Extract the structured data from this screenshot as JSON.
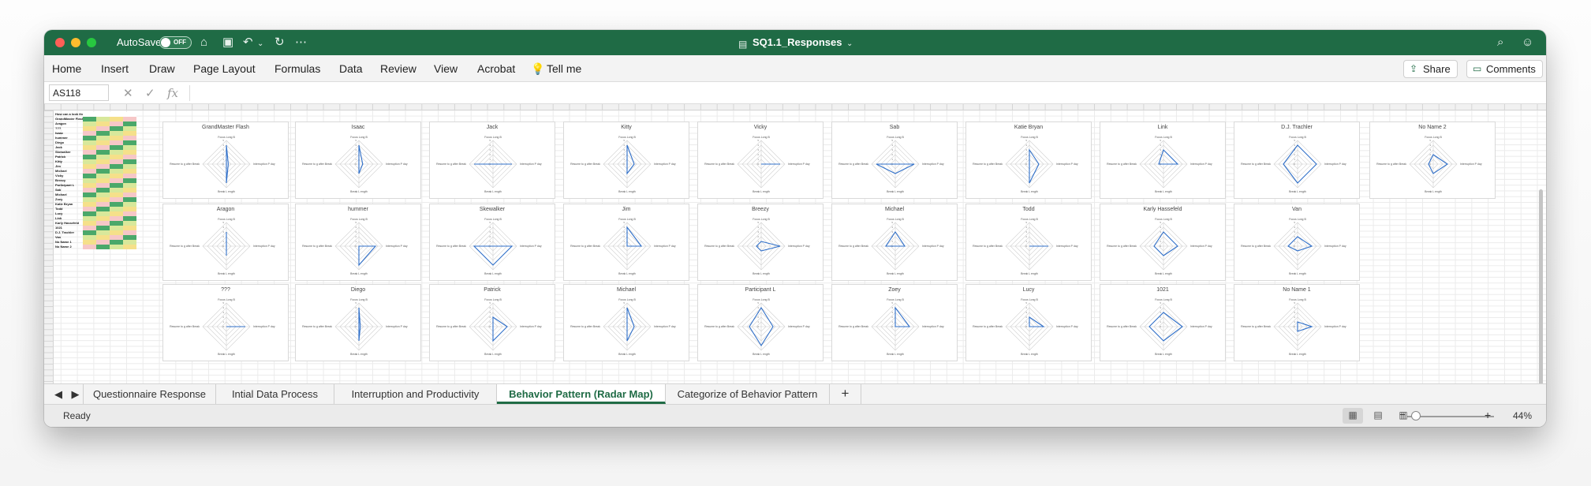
{
  "window": {
    "title": "SQ1.1_Responses"
  },
  "titlebar": {
    "autosave_label": "AutoSave",
    "toggle_state": "OFF"
  },
  "ribbon": {
    "tabs": [
      "Home",
      "Insert",
      "Draw",
      "Page Layout",
      "Formulas",
      "Data",
      "Review",
      "View",
      "Acrobat"
    ],
    "tell_me": "Tell me",
    "share": "Share",
    "comments": "Comments"
  },
  "formula_bar": {
    "name_box": "AS118",
    "fx": "fx",
    "value": ""
  },
  "data_table": {
    "rows": [
      "How can a look the le",
      "GrandMaster Flash",
      "Aragon",
      "???",
      "Isaac",
      "hummer",
      "Diego",
      "Jack",
      "Skewalker",
      "Patrick",
      "Kitty",
      "Jim",
      "Michael",
      "Vicky",
      "Breezy",
      "Participant L",
      "Sab",
      "Michael",
      "Zoey",
      "Katie Bryan",
      "Todd",
      "Lucy",
      "Link",
      "Karly Hassefeld",
      "1021",
      "D.J. Trachler",
      "Van",
      "No Name 1",
      "No Name 2"
    ],
    "colors": [
      "#f6c7c7",
      "#4aa86a",
      "#d8e89b",
      "#f5e08a"
    ]
  },
  "radar_axes": [
    "Focus Long B",
    "Interruption P day",
    "Break L ength",
    "Resume to g after Break"
  ],
  "radar_ticks": [
    "5",
    "4",
    "3",
    "2",
    "1",
    "0"
  ],
  "charts": [
    {
      "name": "GrandMaster Flash",
      "values": [
        4,
        0.4,
        4,
        0
      ]
    },
    {
      "name": "Aragon",
      "values": [
        3,
        0,
        2,
        0
      ]
    },
    {
      "name": "???",
      "values": [
        0,
        4,
        0,
        0
      ]
    },
    {
      "name": "Isaac",
      "values": [
        4,
        0.8,
        2,
        0
      ]
    },
    {
      "name": "hummer",
      "values": [
        0,
        3.5,
        4,
        0
      ]
    },
    {
      "name": "Diego",
      "values": [
        4,
        0.3,
        3,
        0
      ]
    },
    {
      "name": "Jack",
      "values": [
        0,
        4,
        0,
        4
      ]
    },
    {
      "name": "Skewalker",
      "values": [
        0,
        4,
        4,
        4
      ]
    },
    {
      "name": "Patrick",
      "values": [
        2,
        3,
        3,
        0
      ]
    },
    {
      "name": "Kitty",
      "values": [
        4,
        1.5,
        2,
        0
      ]
    },
    {
      "name": "Jim",
      "values": [
        4,
        3,
        0,
        0
      ]
    },
    {
      "name": "Michael",
      "values": [
        4,
        1.5,
        3,
        0
      ]
    },
    {
      "name": "Vicky",
      "values": [
        0,
        4,
        0,
        0
      ]
    },
    {
      "name": "Breezy",
      "values": [
        1,
        4,
        1,
        1
      ]
    },
    {
      "name": "Participant L",
      "values": [
        4,
        2.5,
        4,
        2.5
      ]
    },
    {
      "name": "Sab",
      "values": [
        0,
        4,
        2,
        4
      ]
    },
    {
      "name": "Michael",
      "values": [
        3,
        2,
        0,
        2
      ]
    },
    {
      "name": "Zoey",
      "values": [
        4,
        3,
        0,
        0
      ]
    },
    {
      "name": "Katie Bryan",
      "values": [
        3,
        2,
        4,
        0
      ]
    },
    {
      "name": "Todd",
      "values": [
        0,
        4,
        0,
        0
      ]
    },
    {
      "name": "Lucy",
      "values": [
        2,
        3,
        0,
        0
      ]
    },
    {
      "name": "Link",
      "values": [
        3,
        3,
        0,
        1
      ]
    },
    {
      "name": "Karly Hassefeld",
      "values": [
        3,
        3,
        2,
        2
      ]
    },
    {
      "name": "1021",
      "values": [
        3,
        4,
        3,
        3
      ]
    },
    {
      "name": "D.J. Trachler",
      "values": [
        4,
        4,
        4,
        3
      ]
    },
    {
      "name": "Van",
      "values": [
        2,
        3,
        1,
        2
      ]
    },
    {
      "name": "No Name 1",
      "values": [
        1,
        3,
        1,
        0
      ]
    },
    {
      "name": "No Name 2",
      "values": [
        2,
        3,
        2,
        1
      ]
    }
  ],
  "sheet_tabs": [
    "Questionnaire Response",
    "Intial Data Process",
    "Interruption and Productivity",
    "Behavior Pattern (Radar Map)",
    "Categorize of Behavior Pattern"
  ],
  "active_tab": "Behavior Pattern (Radar Map)",
  "status": {
    "text": "Ready",
    "zoom": "44%"
  },
  "colors": {
    "excel_green": "#1f6b45",
    "radar_line": "#2f6fc9"
  }
}
